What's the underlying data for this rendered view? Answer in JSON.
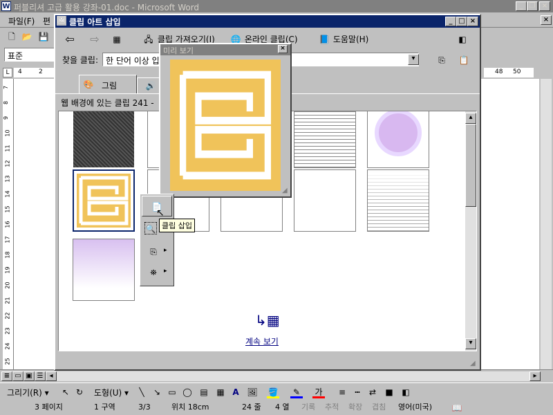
{
  "word": {
    "title": "퍼블리셔 고급 활용 강좌-01.doc - Microsoft Word",
    "menu_file": "파일(F)",
    "menu_edit": "편",
    "style": "표준",
    "ruler_right": [
      "48",
      "50"
    ],
    "ruler_left": [
      "4",
      "2"
    ],
    "vruler": [
      "7",
      "8",
      "9",
      "10",
      "11",
      "12",
      "13",
      "14",
      "15",
      "16",
      "17",
      "18",
      "19",
      "20",
      "21",
      "22",
      "23",
      "24",
      "25"
    ]
  },
  "clipart": {
    "title": "클립 아트 삽입",
    "back": "⇦",
    "forward": "⇨",
    "import": "클립 가져오기(I)",
    "online": "온라인 클립(C)",
    "help": "도움말(H)",
    "search_label": "찾을 클립:",
    "search_value": "한 단어 이상 입",
    "tab_pictures": "그림",
    "status": "웹 배경에 있는 클립 241 -",
    "more": "계속 보기"
  },
  "preview": {
    "title": "미리 보기"
  },
  "popup": {
    "tooltip": "클립 삽입"
  },
  "drawing": {
    "draw": "그리기(R)",
    "autoshapes": "도형(U)",
    "font_char": "가"
  },
  "statusbar": {
    "page": "3 페이지",
    "section": "1 구역",
    "pages": "3/3",
    "at": "위치 18cm",
    "line": "24 줄",
    "col": "4 열",
    "rec": "기록",
    "trk": "추적",
    "ext": "확장",
    "ovr": "겹침",
    "lang": "영어(미국)"
  },
  "colors": {
    "title_active": "#0a246a",
    "title_inactive": "#808080",
    "meander": "#f0c35a",
    "link": "#000080"
  }
}
